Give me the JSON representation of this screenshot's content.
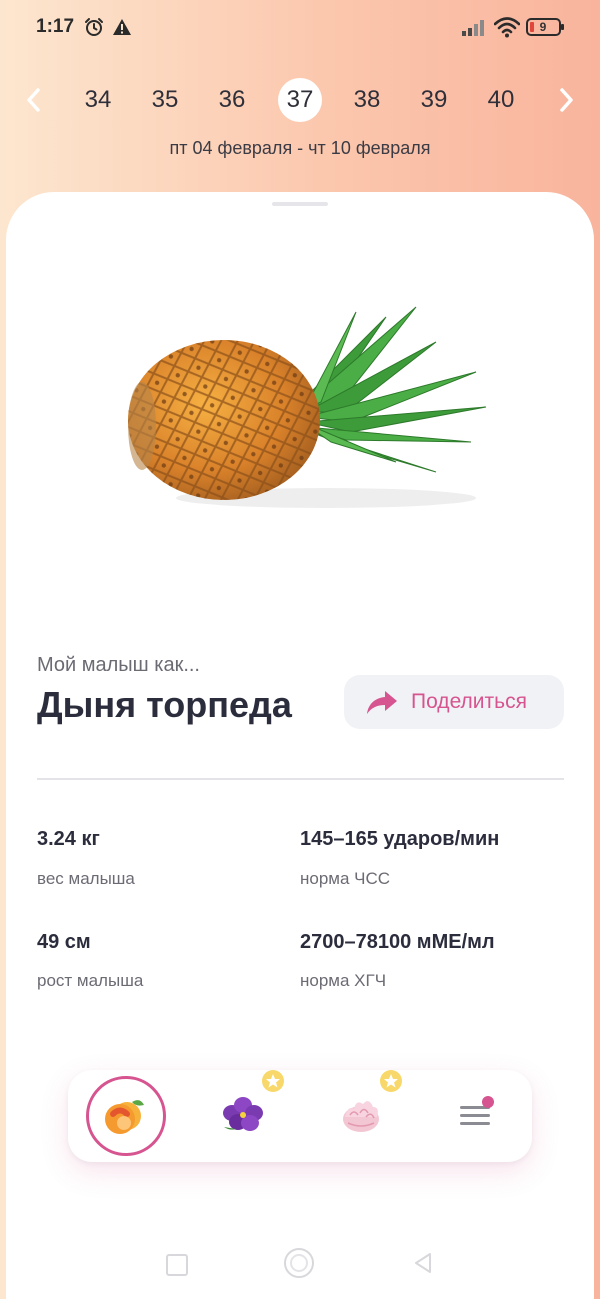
{
  "status_bar": {
    "time": "1:17",
    "battery_level": "9",
    "icons": [
      "alarm-icon",
      "warning-icon",
      "signal-icon",
      "wifi-icon",
      "battery-icon"
    ]
  },
  "week_nav": {
    "weeks": [
      "34",
      "35",
      "36",
      "37",
      "38",
      "39",
      "40"
    ],
    "selected": "37",
    "date_range": "пт 04 февраля - чт 10 февраля"
  },
  "baby": {
    "caption": "Мой малыш как...",
    "name": "Дыня торпеда",
    "image": "pineapple-illustration"
  },
  "share": {
    "label": "Поделиться"
  },
  "stats": {
    "weight_value": "3.24 кг",
    "weight_label": "вес малыша",
    "heart_value": "145–165 ударов/мин",
    "heart_label": "норма ЧСС",
    "height_value": "49 см",
    "height_label": "рост малыша",
    "hcg_value": "2700–78100 мМЕ/мл",
    "hcg_label": "норма ХГЧ"
  },
  "tabbar": {
    "tabs": [
      "peach-icon",
      "violet-flower-icon",
      "marshmallow-icon",
      "menu-icon"
    ],
    "active_tab": "peach-icon"
  },
  "colors": {
    "accent": "#d6548f",
    "text_dark": "#2b2d3d",
    "text_muted": "#6b6b74",
    "gradient_start": "#fde6cf",
    "gradient_end": "#f9b49d"
  }
}
